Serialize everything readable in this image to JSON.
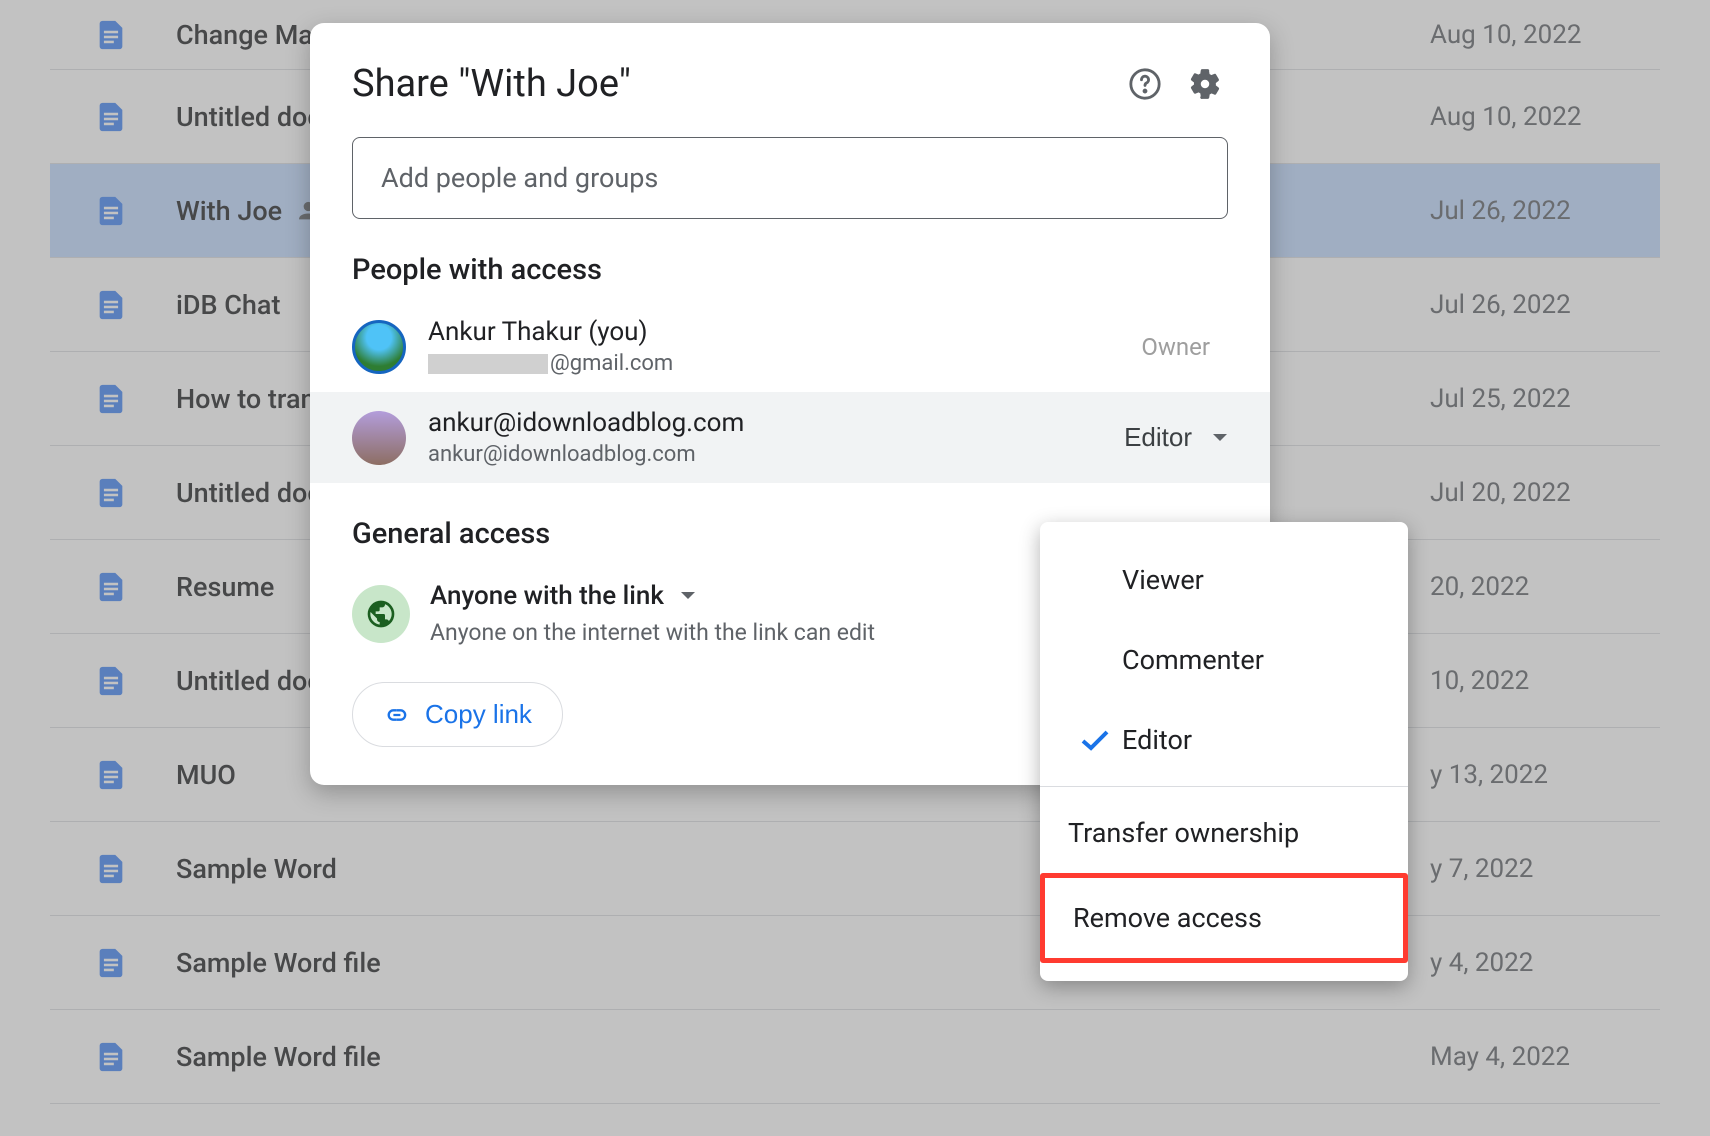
{
  "files": [
    {
      "name": "Change Mac",
      "date": "Aug 10, 2022",
      "shared": false,
      "selected": false
    },
    {
      "name": "Untitled docu",
      "date": "Aug 10, 2022",
      "shared": false,
      "selected": false
    },
    {
      "name": "With Joe",
      "date": "Jul 26, 2022",
      "shared": true,
      "selected": true
    },
    {
      "name": "iDB Chat",
      "date": "Jul 26, 2022",
      "shared": false,
      "selected": false
    },
    {
      "name": "How to trans",
      "date": "Jul 25, 2022",
      "shared": false,
      "selected": false
    },
    {
      "name": "Untitled docu",
      "date": "Jul 20, 2022",
      "shared": false,
      "selected": false
    },
    {
      "name": "Resume",
      "date": "20, 2022",
      "shared": false,
      "selected": false
    },
    {
      "name": "Untitled docu",
      "date": "10, 2022",
      "shared": false,
      "selected": false
    },
    {
      "name": "MUO",
      "date": "y 13, 2022",
      "shared": false,
      "selected": false
    },
    {
      "name": "Sample Word",
      "date": "y 7, 2022",
      "shared": false,
      "selected": false
    },
    {
      "name": "Sample Word file",
      "date": "y 4, 2022",
      "shared": false,
      "selected": false
    },
    {
      "name": "Sample Word file",
      "date": "May 4, 2022",
      "shared": false,
      "selected": false
    }
  ],
  "dialog": {
    "title": "Share \"With Joe\"",
    "add_placeholder": "Add people and groups",
    "people_section": "People with access",
    "owner": {
      "name": "Ankur Thakur (you)",
      "email_suffix": "@gmail.com",
      "role": "Owner"
    },
    "editor": {
      "name": "ankur@idownloadblog.com",
      "email": "ankur@idownloadblog.com",
      "role": "Editor"
    },
    "general_section": "General access",
    "general_access": {
      "title": "Anyone with the link",
      "sub": "Anyone on the internet with the link can edit"
    },
    "copy_link": "Copy link"
  },
  "role_menu": {
    "viewer": "Viewer",
    "commenter": "Commenter",
    "editor": "Editor",
    "transfer": "Transfer ownership",
    "remove": "Remove access"
  }
}
